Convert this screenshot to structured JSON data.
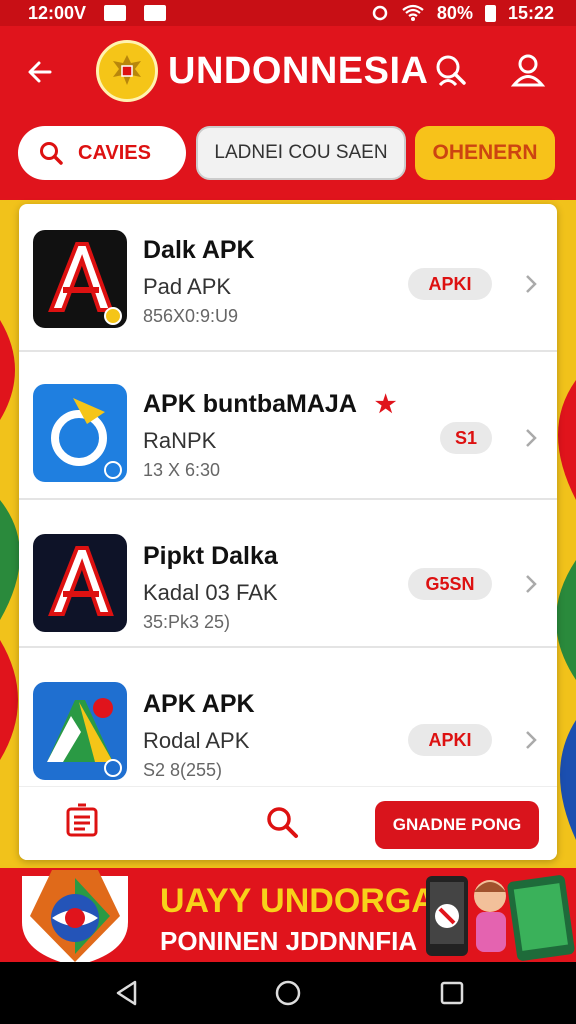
{
  "status_bar": {
    "time": "12:00V",
    "battery": "80%",
    "clock": "15:22"
  },
  "header": {
    "title": "UNDONNESIA"
  },
  "filters": {
    "games": "CAVIES",
    "language": "LADNEI COU SAEN",
    "other": "OHENERN"
  },
  "apps": [
    {
      "name": "Dalk APK",
      "sub": "Pad APK",
      "meta": "856X0:9:U9",
      "badge": "APKI",
      "starred": false
    },
    {
      "name": "APK buntbaMAJA",
      "sub": "RaNPK",
      "meta": "13 X 6:30",
      "badge": "S1",
      "starred": true,
      "star": "★"
    },
    {
      "name": "Pipkt Dalka",
      "sub": "Kadal 03 FAK",
      "meta": "35:Pk3 25)",
      "badge": "G5SN",
      "starred": false
    },
    {
      "name": "APK APK",
      "sub": "Rodal APK",
      "meta": "S2 8(255)",
      "badge": "APKI",
      "starred": false
    }
  ],
  "toolbar": {
    "action_label": "GNADNE PONG"
  },
  "banner": {
    "line1": "UAYY UNDORGAN",
    "line2": "PONINEN JDDNNFIA"
  },
  "colors": {
    "primary": "#e0141c",
    "accent": "#f7c21a"
  }
}
